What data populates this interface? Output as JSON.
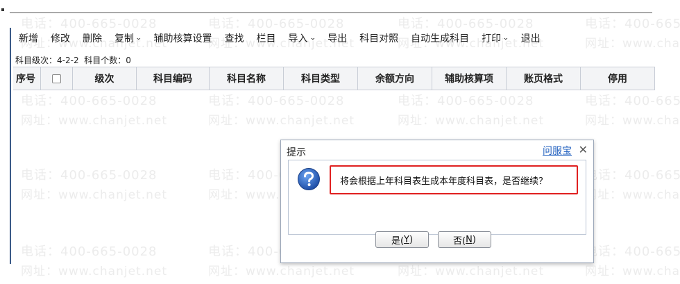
{
  "watermark": {
    "phone": "电话：400-665-0028",
    "url": "网址：www.chanjet.net"
  },
  "toolbar": {
    "items": [
      {
        "label": "新增",
        "has_menu": false
      },
      {
        "label": "修改",
        "has_menu": false
      },
      {
        "label": "删除",
        "has_menu": false
      },
      {
        "label": "复制",
        "has_menu": true
      },
      {
        "label": "辅助核算设置",
        "has_menu": false
      },
      {
        "label": "查找",
        "has_menu": false
      },
      {
        "label": "栏目",
        "has_menu": false
      },
      {
        "label": "导入",
        "has_menu": true
      },
      {
        "label": "导出",
        "has_menu": false
      },
      {
        "label": "科目对照",
        "has_menu": false
      },
      {
        "label": "自动生成科目",
        "has_menu": false
      },
      {
        "label": "打印",
        "has_menu": true
      },
      {
        "label": "退出",
        "has_menu": false
      }
    ],
    "caret_glyph": "⌄"
  },
  "level_info": {
    "level_label": "科目级次：",
    "level_value": "4-2-2",
    "count_label": "科目个数：",
    "count_value": "0"
  },
  "grid": {
    "columns": [
      "序号",
      "",
      "级次",
      "科目编码",
      "科目名称",
      "科目类型",
      "余额方向",
      "辅助核算项",
      "账页格式",
      "停用"
    ]
  },
  "dialog": {
    "title": "提示",
    "help_link": "问服宝",
    "close_glyph": "✕",
    "message": "将会根据上年科目表生成本年度科目表，是否继续？",
    "yes_label": "是(",
    "yes_key": "Y",
    "no_label": "否(",
    "no_key": "N",
    "close_paren": ")"
  },
  "colors": {
    "highlight": "#e02020",
    "help_link": "#1f5fbf",
    "icon_blue": "#2f6bd1"
  }
}
